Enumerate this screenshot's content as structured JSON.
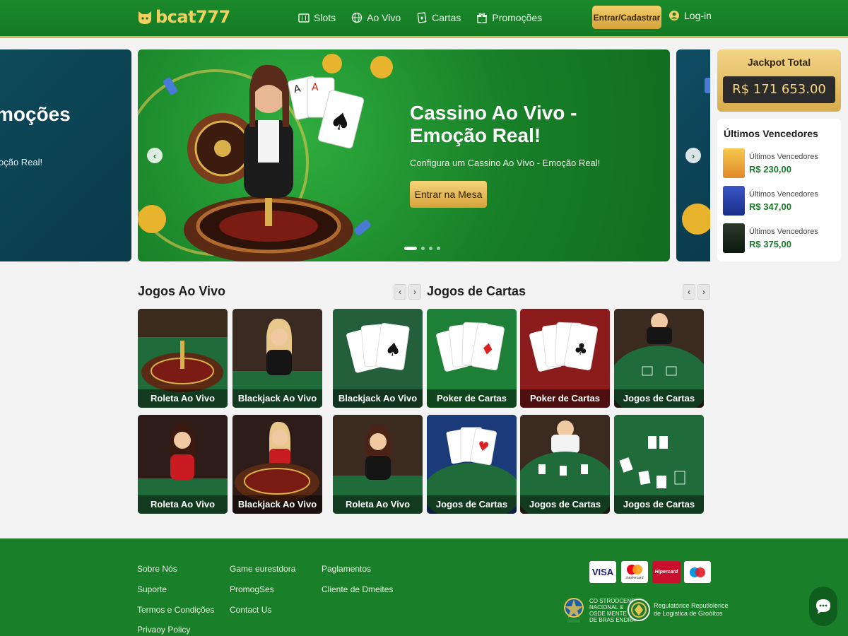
{
  "header": {
    "logo_text": "bcat777",
    "nav": [
      {
        "label": "Slots",
        "icon": "slot-machine-icon"
      },
      {
        "label": "Ao Vivo",
        "icon": "globe-icon"
      },
      {
        "label": "Cartas",
        "icon": "card-icon"
      },
      {
        "label": "Promoções",
        "icon": "gift-icon"
      }
    ],
    "register_label": "Entrar/Cadastrar",
    "login_label": "Log-in"
  },
  "hero": {
    "prev_slide_title": "moções",
    "prev_slide_sub": "oção Real!",
    "title": "Cassino Ao Vivo - Emoção Real!",
    "subtitle": "Configura um Cassino Ao Vivo - Emoção Real!",
    "cta_label": "Entrar na Mesa"
  },
  "jackpot": {
    "label": "Jackpot Total",
    "value": "R$ 171 653.00"
  },
  "winners": {
    "title": "Últimos Vencedores",
    "items": [
      {
        "label": "Últimos Vencedores",
        "amount": "R$ 230,00"
      },
      {
        "label": "Últimos Vencedores",
        "amount": "R$ 347,00"
      },
      {
        "label": "Últimos Vencedores",
        "amount": "R$ 375,00"
      }
    ]
  },
  "live_games": {
    "title": "Jogos Ao Vivo",
    "cards": [
      {
        "caption": "Roleta Ao Vivo"
      },
      {
        "caption": "Blackjack Ao Vivo"
      },
      {
        "caption": "Blackjack Ao Vivo"
      },
      {
        "caption": "Roleta Ao Vivo"
      },
      {
        "caption": "Blackjack Ao Vivo"
      },
      {
        "caption": "Roleta Ao Vivo"
      }
    ]
  },
  "card_games": {
    "title": "Jogos de Cartas",
    "cards": [
      {
        "caption": "Poker de Cartas"
      },
      {
        "caption": "Poker de Cartas"
      },
      {
        "caption": "Jogos de Cartas"
      },
      {
        "caption": "Jogos de Cartas"
      },
      {
        "caption": "Jogos de Cartas"
      },
      {
        "caption": "Jogos de Cartas"
      }
    ]
  },
  "footer": {
    "col1": [
      "Sobre Nós",
      "Suporte",
      "Termos e Condições",
      "Privaoy Policy"
    ],
    "col2": [
      "Game eurestdora",
      "PromogSes",
      "Contact Us"
    ],
    "col3": [
      "Paglamentos",
      "Cliente de Dmeites"
    ],
    "payments": [
      "VISA",
      "mastercard",
      "Hipercard",
      "maestro"
    ],
    "reg1": [
      "CO STRODCENE",
      "NACIONAL &",
      "OSDE MENTE",
      "DE BRAS ENDRA"
    ],
    "reg2": [
      "Regulatórice Reputlolerice",
      "de Logistica de Groóítos"
    ]
  },
  "colors": {
    "brand_green": "#1a7f29",
    "gold": "#f2cf6a"
  }
}
